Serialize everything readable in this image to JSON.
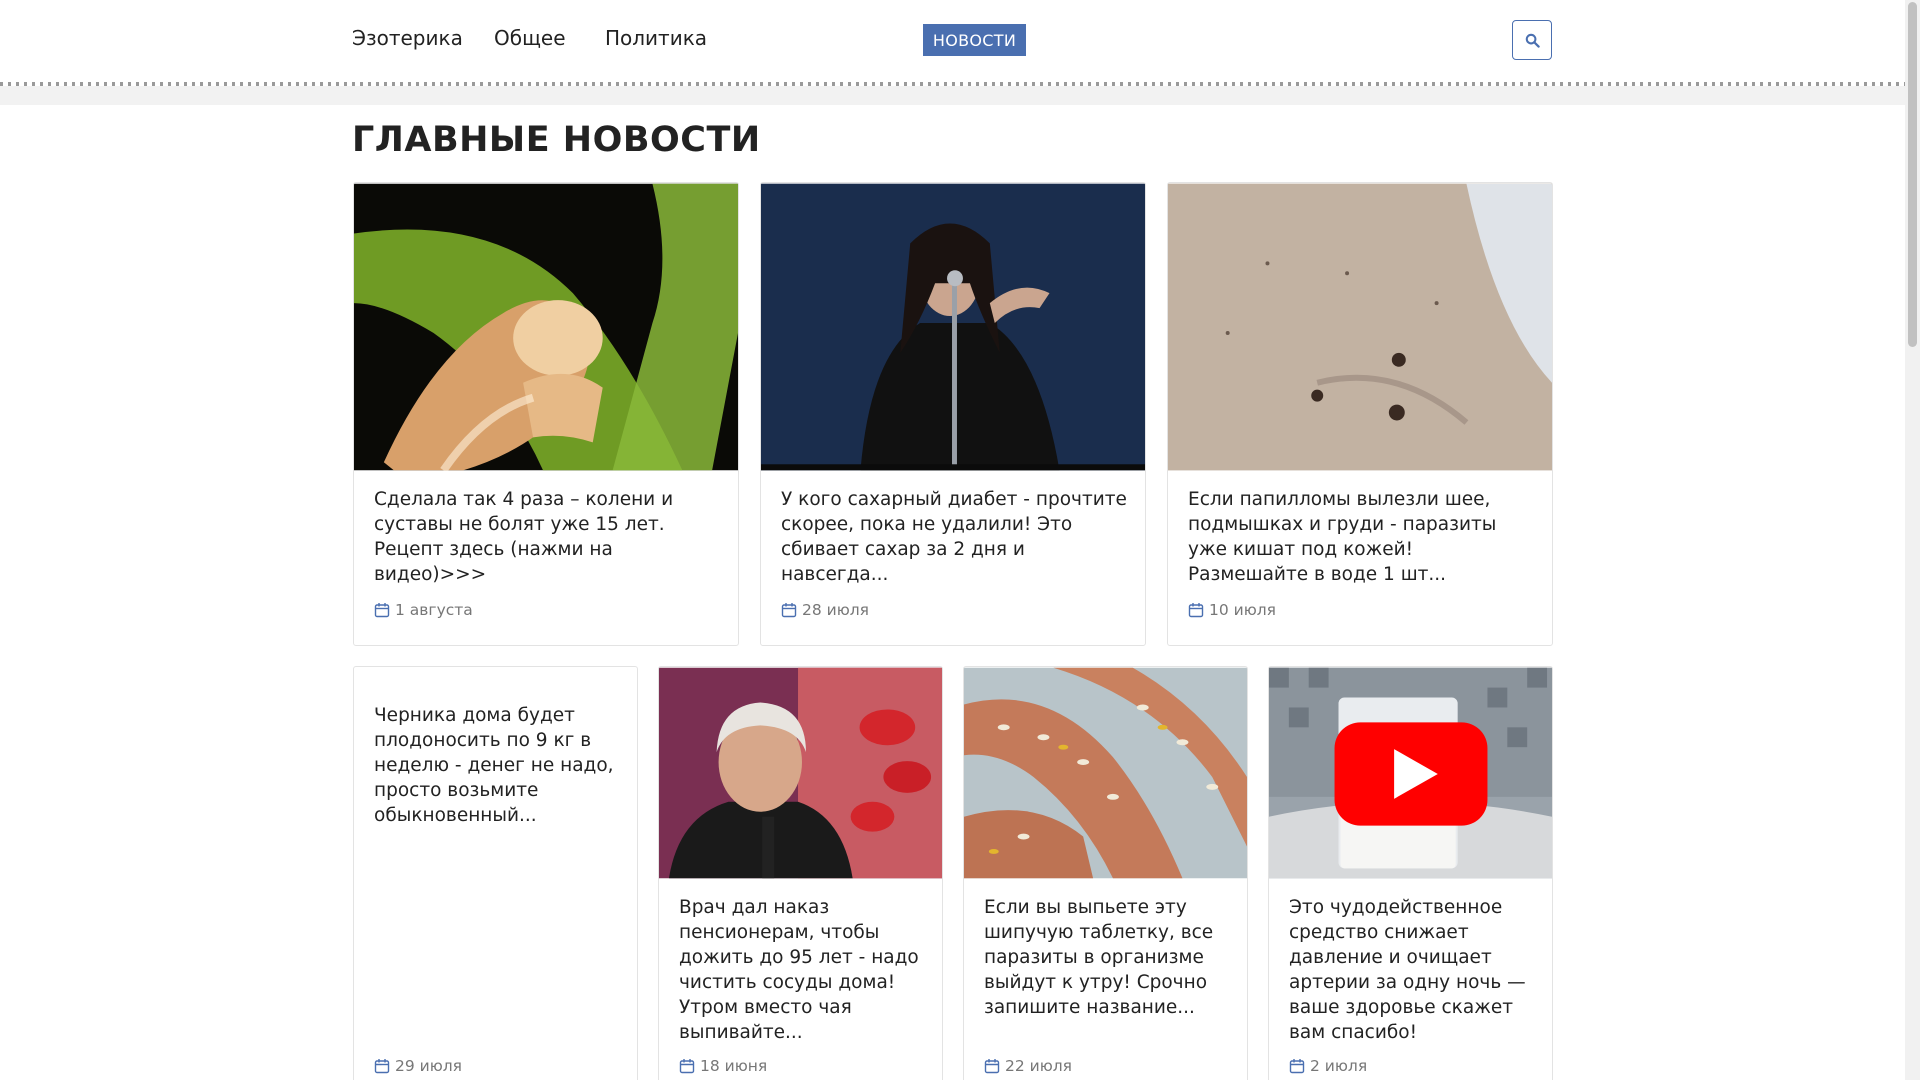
{
  "nav": {
    "items": [
      "Эзотерика",
      "Общее",
      "Политика"
    ],
    "news_button": "НОВОСТИ",
    "search_icon": "search-icon"
  },
  "section": {
    "title": "ГЛАВНЫЕ НОВОСТИ"
  },
  "cards": [
    {
      "title": "Сделала так 4 раза – колени и суставы не болят уже 15 лет. Рецепт здесь (нажми на видео)>>>",
      "date": "1 августа",
      "image": "knee-joint-xray"
    },
    {
      "title": "У кого сахарный диабет - прочтите скорее, пока не удалили! Это сбивает сахар за 2 дня и навсегда...",
      "date": "28 июля",
      "image": "singer-on-stage"
    },
    {
      "title": "Если папилломы вылезли шее, подмышках и груди - паразиты уже кишат под кожей! Размешайте в воде 1 шт...",
      "date": "10 июля",
      "image": "neck-skin-papillomas"
    },
    {
      "title": "Черника дома будет плодоносить по 9 кг в неделю - денег не надо, просто возьмите обыкновенный...",
      "date": "29 июля",
      "image": ""
    },
    {
      "title": "Врач дал наказ пенсионерам, чтобы дожить до 95 лет - надо чистить сосуды дома! Утром вместо чая выпивайте...",
      "date": "18 июня",
      "image": "elderly-man-portrait"
    },
    {
      "title": "Если вы выпьете эту шипучую таблетку, все паразиты в организме выйдут к утру! Срочно запишите название...",
      "date": "22 июля",
      "image": "fingers-with-parasites"
    },
    {
      "title": "Это чудодейственное средство снижает давление и очищает артерии за одну ночь — ваше здоровье скажет вам спасибо!",
      "date": "2 июля",
      "image": "glass-of-milk-video"
    }
  ],
  "colors": {
    "accent": "#4a6fb0",
    "text": "#222222",
    "date": "#777777",
    "border": "#e3e3e3"
  }
}
